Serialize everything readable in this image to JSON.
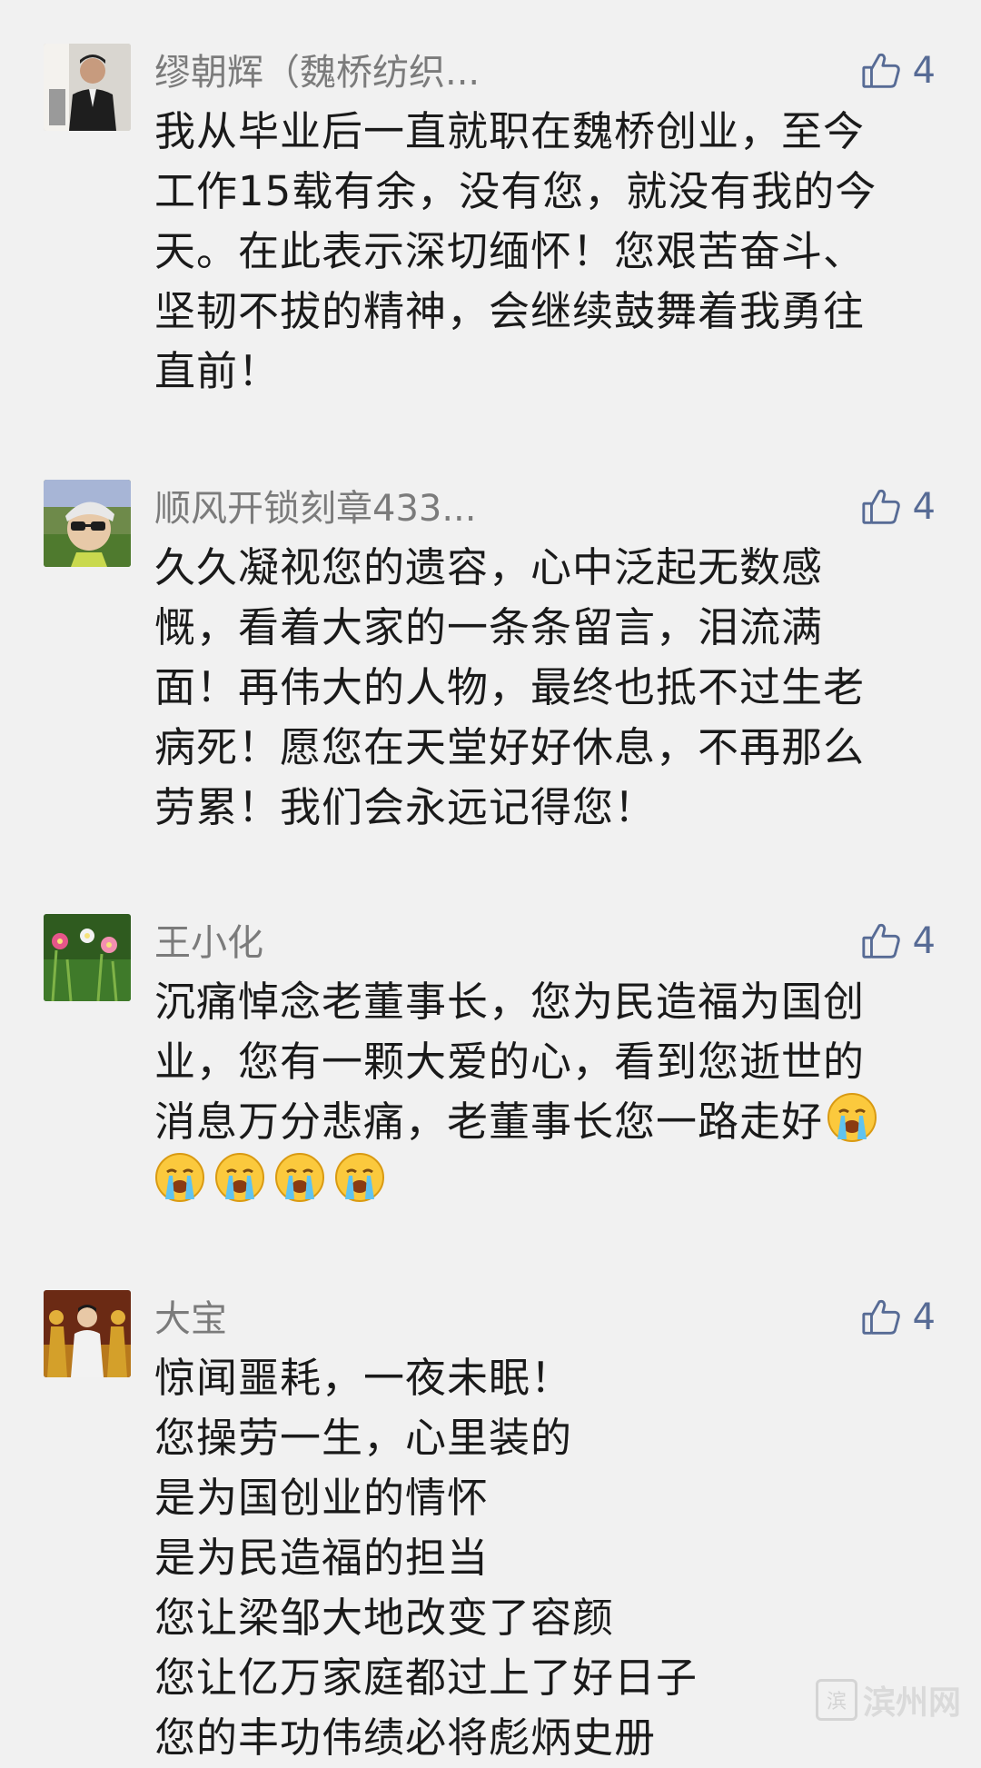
{
  "comments": [
    {
      "name": "缪朝辉（魏桥纺织...",
      "likes": "4",
      "avatar": "man-in-suit-avatar",
      "lines": [
        "我从毕业后一直就职在魏桥创业，至今",
        "工作15载有余，没有您，就没有我的今",
        "天。在此表示深切缅怀！您艰苦奋斗、",
        "坚韧不拔的精神，会继续鼓舞着我勇往",
        "直前！"
      ]
    },
    {
      "name": "顺风开锁刻章433...",
      "likes": "4",
      "avatar": "person-with-sunglasses-avatar",
      "lines": [
        "久久凝视您的遗容，心中泛起无数感",
        "慨，看着大家的一条条留言，泪流满",
        "面！再伟大的人物，最终也抵不过生老",
        "病死！愿您在天堂好好休息，不再那么",
        "劳累！我们会永远记得您！"
      ]
    },
    {
      "name": "王小化",
      "likes": "4",
      "avatar": "flowers-avatar",
      "lines": [
        "沉痛悼念老董事长，您为民造福为国创",
        "业，您有一颗大爱的心，看到您逝世的",
        "消息万分悲痛，老董事长您一路走好"
      ],
      "emoji": "crying-face-icon"
    },
    {
      "name": "大宝",
      "likes": "4",
      "avatar": "stage-performers-avatar",
      "lines": [
        "惊闻噩耗，一夜未眠！",
        "您操劳一生，心里装的",
        "是为国创业的情怀",
        "是为民造福的担当",
        "您让梁邹大地改变了容颜",
        "您让亿万家庭都过上了好日子",
        "您的丰功伟绩必将彪炳史册"
      ]
    }
  ],
  "watermark": {
    "mark": "滨",
    "text": "滨州网"
  },
  "colors": {
    "background": "#f1f1f1",
    "name": "#7b7b7b",
    "like": "#576b95",
    "text": "#1a1a1a"
  }
}
